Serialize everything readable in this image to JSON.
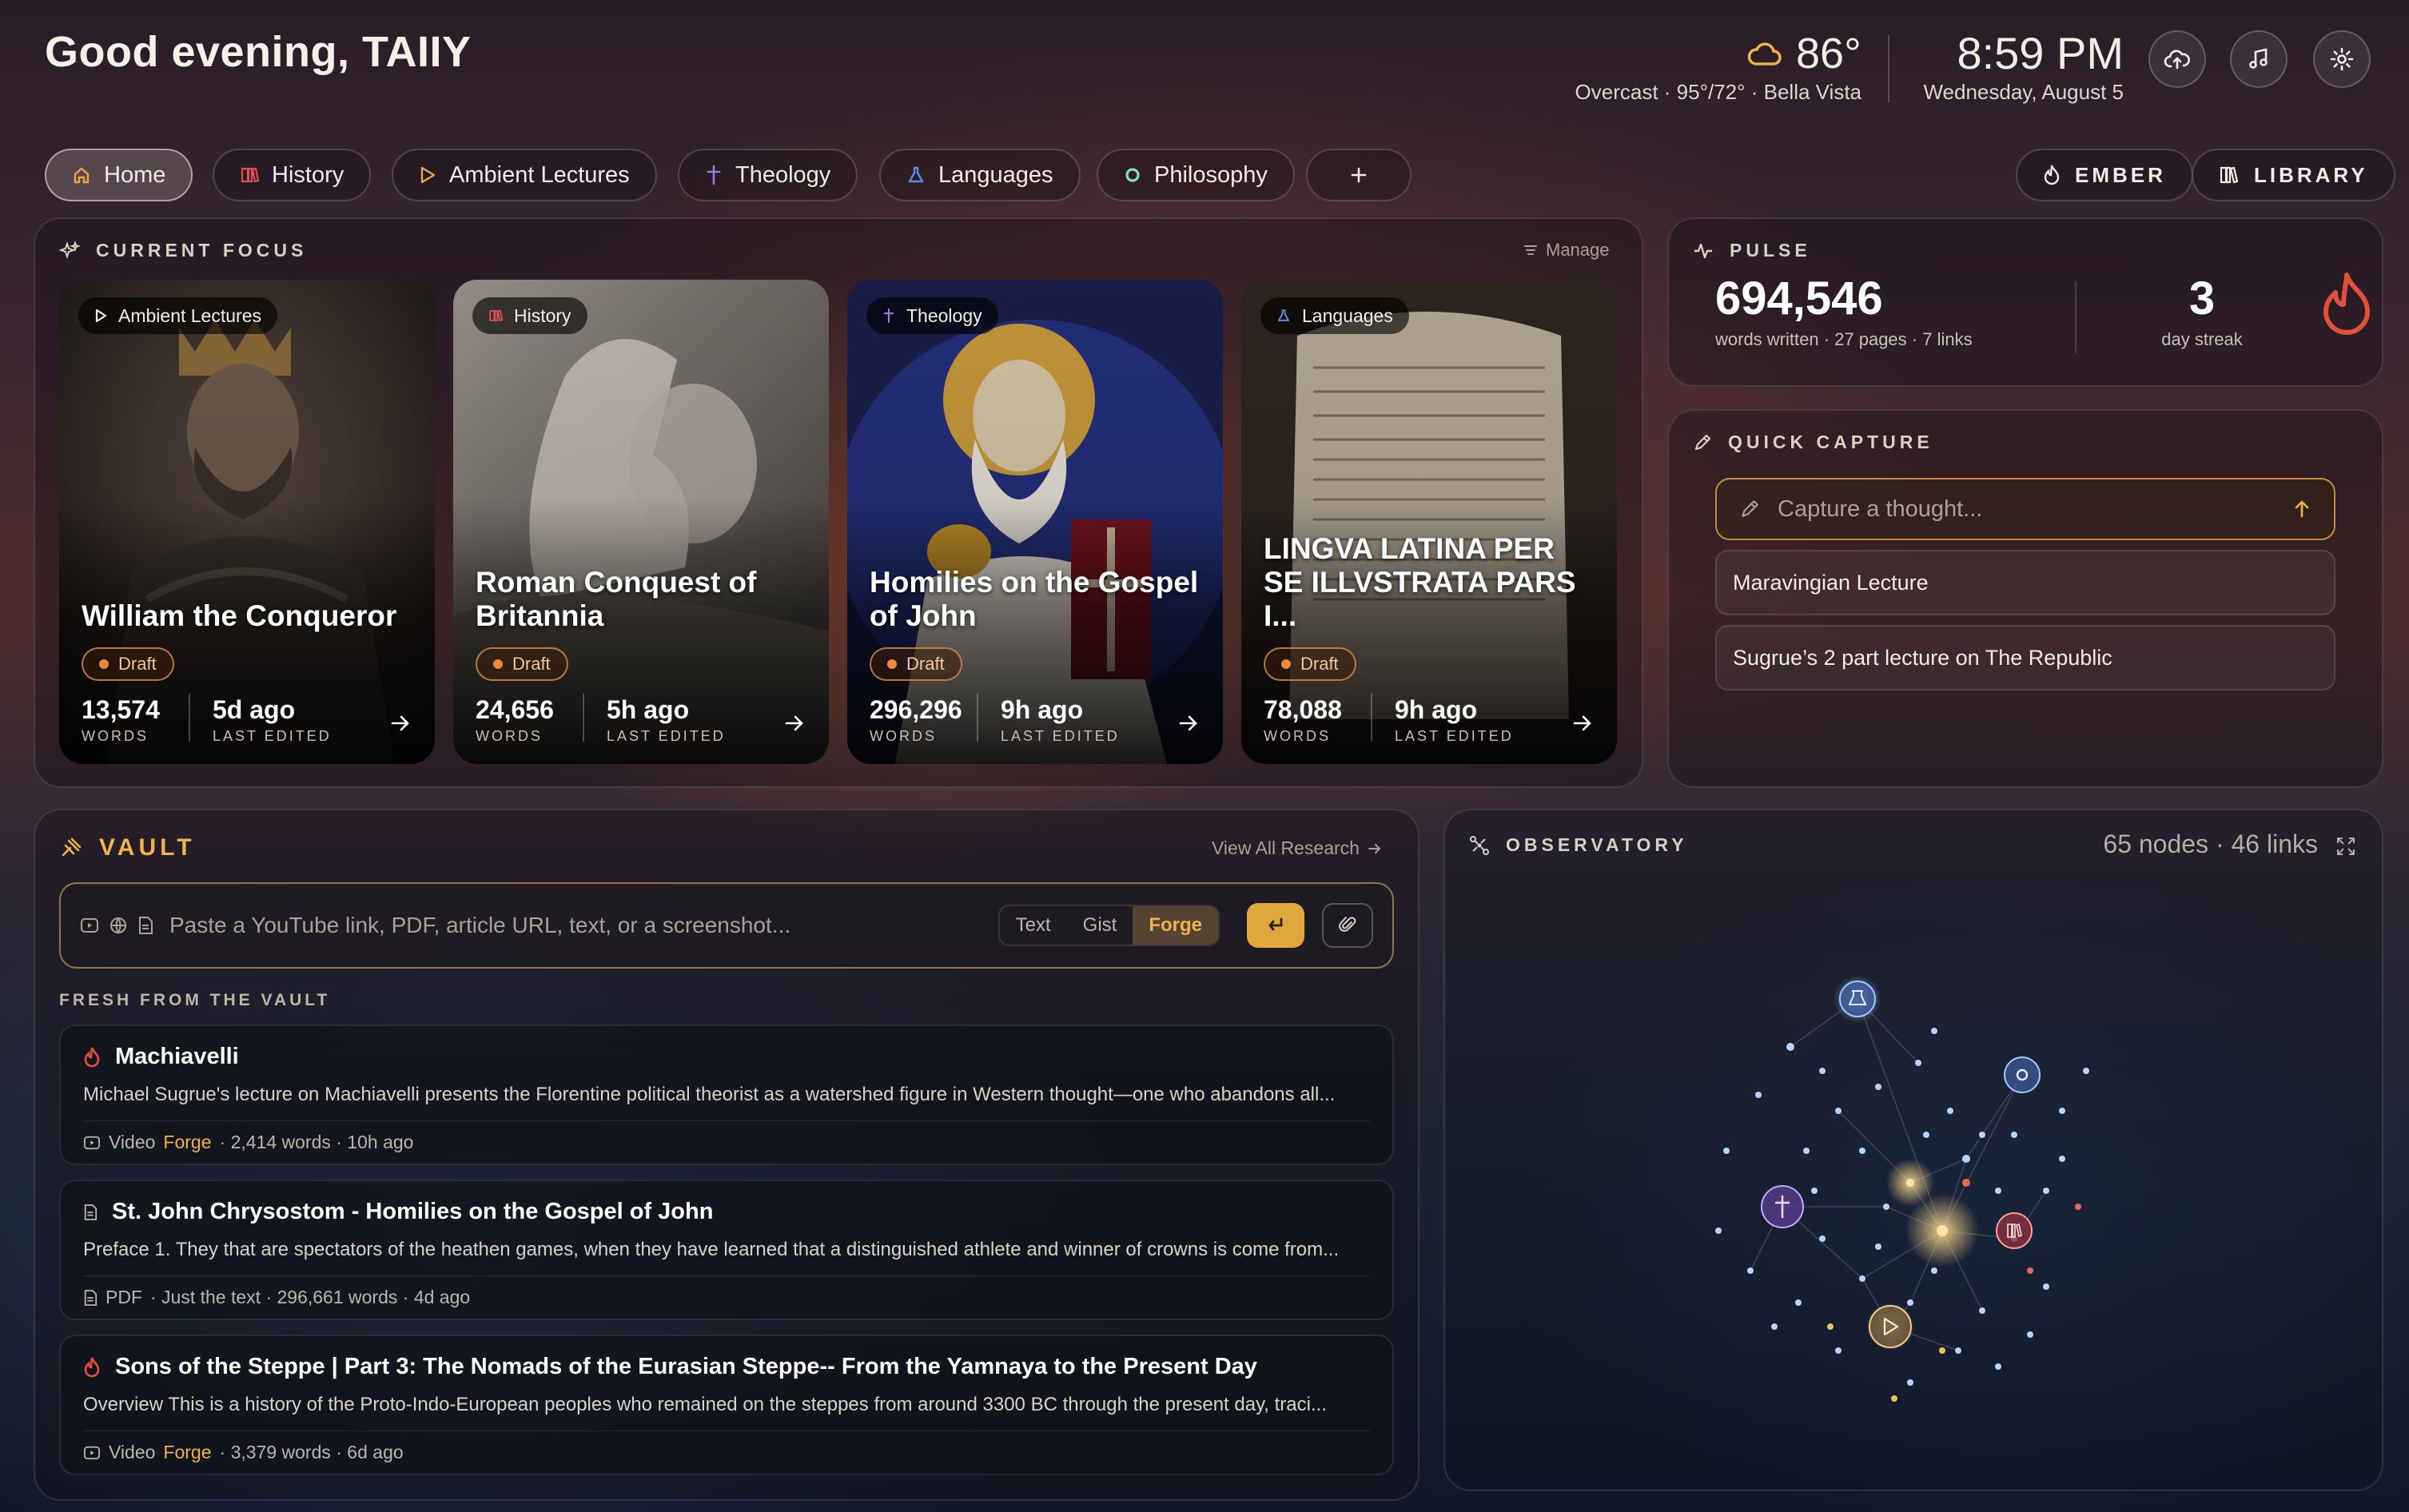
{
  "header": {
    "greeting": "Good evening, TAIIY",
    "weather": {
      "temp": "86°",
      "summary": "Overcast · 95°/72° · Bella Vista"
    },
    "clock": {
      "time": "8:59 PM",
      "date": "Wednesday, August 5"
    },
    "actions": {
      "cloud": "cloud-sync-icon",
      "music": "music-icon",
      "settings": "gear-icon"
    }
  },
  "nav": {
    "tabs": [
      {
        "label": "Home",
        "icon": "home-icon",
        "active": true
      },
      {
        "label": "History",
        "icon": "book-icon"
      },
      {
        "label": "Ambient Lectures",
        "icon": "play-icon"
      },
      {
        "label": "Theology",
        "icon": "cross-icon"
      },
      {
        "label": "Languages",
        "icon": "flask-icon"
      },
      {
        "label": "Philosophy",
        "icon": "circle-icon"
      }
    ],
    "ember_label": "EMBER",
    "library_label": "LIBRARY"
  },
  "focus": {
    "title": "CURRENT FOCUS",
    "manage": "Manage",
    "cards": [
      {
        "category": "Ambient Lectures",
        "title": "William the Conqueror",
        "status": "Draft",
        "words": "13,574",
        "words_label": "WORDS",
        "edited": "5d ago",
        "edited_label": "LAST EDITED"
      },
      {
        "category": "History",
        "title": "Roman Conquest of Britannia",
        "status": "Draft",
        "words": "24,656",
        "words_label": "WORDS",
        "edited": "5h ago",
        "edited_label": "LAST EDITED"
      },
      {
        "category": "Theology",
        "title": "Homilies on the Gospel of John",
        "status": "Draft",
        "words": "296,296",
        "words_label": "WORDS",
        "edited": "9h ago",
        "edited_label": "LAST EDITED"
      },
      {
        "category": "Languages",
        "title": "LINGVA LATINA PER SE ILLVSTRATA PARS I...",
        "status": "Draft",
        "words": "78,088",
        "words_label": "WORDS",
        "edited": "9h ago",
        "edited_label": "LAST EDITED"
      }
    ]
  },
  "pulse": {
    "title": "PULSE",
    "words": "694,546",
    "words_sub": "words written · 27 pages · 7 links",
    "streak": "3",
    "streak_label": "day streak"
  },
  "capture": {
    "title": "QUICK CAPTURE",
    "placeholder": "Capture a thought...",
    "items": [
      "Maravingian Lecture",
      "Sugrue’s 2 part lecture on The Republic"
    ]
  },
  "vault": {
    "title": "VAULT",
    "view_all": "View All Research",
    "placeholder": "Paste a YouTube link, PDF, article URL, text, or a screenshot...",
    "modes": [
      "Text",
      "Gist",
      "Forge"
    ],
    "selected_mode": "Forge",
    "fresh_label": "FRESH FROM THE VAULT",
    "items": [
      {
        "icon": "flame-icon",
        "title": "Machiavelli",
        "desc": "Michael Sugrue's lecture on Machiavelli presents the Florentine political theorist as a watershed figure in Western thought—one who abandons all...",
        "type": "Video",
        "mode": "Forge",
        "info": "· 2,414 words · 10h ago"
      },
      {
        "icon": "doc-icon",
        "title": "St. John Chrysostom - Homilies on the Gospel of John",
        "desc": "Preface 1. They that are spectators of the heathen games, when they have learned that a distinguished athlete and winner of crowns is come from...",
        "type": "PDF",
        "mode": "",
        "info": "· Just the text · 296,661 words · 4d ago"
      },
      {
        "icon": "flame-icon",
        "title": "Sons of the Steppe | Part 3: The Nomads of the Eurasian Steppe-- From the Yamnaya to the Present Day",
        "desc": "Overview This is a history of the Proto-Indo-European peoples who remained on the steppes from around 3300 BC through the present day, traci...",
        "type": "Video",
        "mode": "Forge",
        "info": "· 3,379 words · 6d ago"
      }
    ]
  },
  "observatory": {
    "title": "OBSERVATORY",
    "stats": "65 nodes · 46 links"
  },
  "colors": {
    "accent": "#f0b24a",
    "flame": "#e0503a",
    "draft": "#e88a3a"
  }
}
